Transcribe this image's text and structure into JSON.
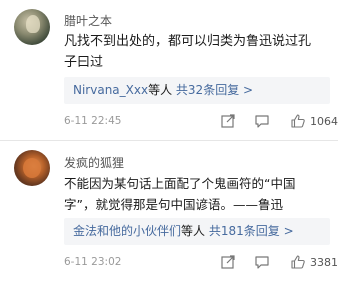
{
  "comments": [
    {
      "username": "腊叶之本",
      "text": "凡找不到出处的，都可以归类为鲁迅说过孔\n子曰过",
      "reply_preview": {
        "users": "Nirvana_Xxx",
        "middle": "等人 ",
        "count_text": "共32条回复 >"
      },
      "time": "6-11 22:45",
      "likes": "1064"
    },
    {
      "username": "发疯的狐狸",
      "text": "不能因为某句话上面配了个鬼画符的“中国\n字”，就觉得那是句中国谚语。——鲁迅",
      "reply_preview": {
        "users": "金法和他的小伙伴们",
        "middle": "等人 ",
        "count_text": "共181条回复 >"
      },
      "time": "6-11 23:02",
      "likes": "3381"
    }
  ],
  "icons": {
    "share": "share-icon",
    "comment": "comment-icon",
    "like": "thumbs-up-icon"
  },
  "colors": {
    "link": "#466a9e",
    "reply_bg": "#f4f5f7",
    "meta_text": "#9a9a9a"
  }
}
